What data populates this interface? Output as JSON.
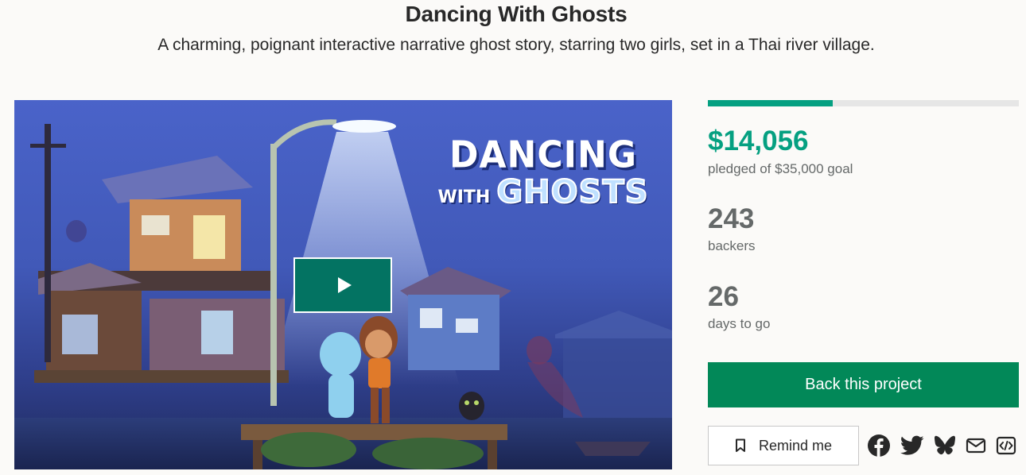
{
  "project": {
    "title": "Dancing With Ghosts",
    "blurb": "A charming, poignant interactive narrative ghost story, starring two girls, set in a Thai river village."
  },
  "video": {
    "logo_line1": "DANCING",
    "logo_with": "WITH",
    "logo_ghosts": "GHOSTS",
    "play_icon": "play-icon"
  },
  "stats": {
    "progress_fraction": 0.4016,
    "pledged_amount": "$14,056",
    "pledged_label": "pledged of $35,000 goal",
    "backers_count": "243",
    "backers_label": "backers",
    "days_count": "26",
    "days_label": "days to go"
  },
  "actions": {
    "back_label": "Back this project",
    "remind_label": "Remind me",
    "remind_icon": "bookmark-icon",
    "share_icons": [
      "facebook-icon",
      "twitter-icon",
      "bluesky-icon",
      "email-icon",
      "embed-icon"
    ]
  },
  "colors": {
    "accent_green": "#05a081",
    "button_green": "#028858",
    "play_button": "#037362",
    "text_dark": "#282828",
    "text_muted": "#656969"
  }
}
